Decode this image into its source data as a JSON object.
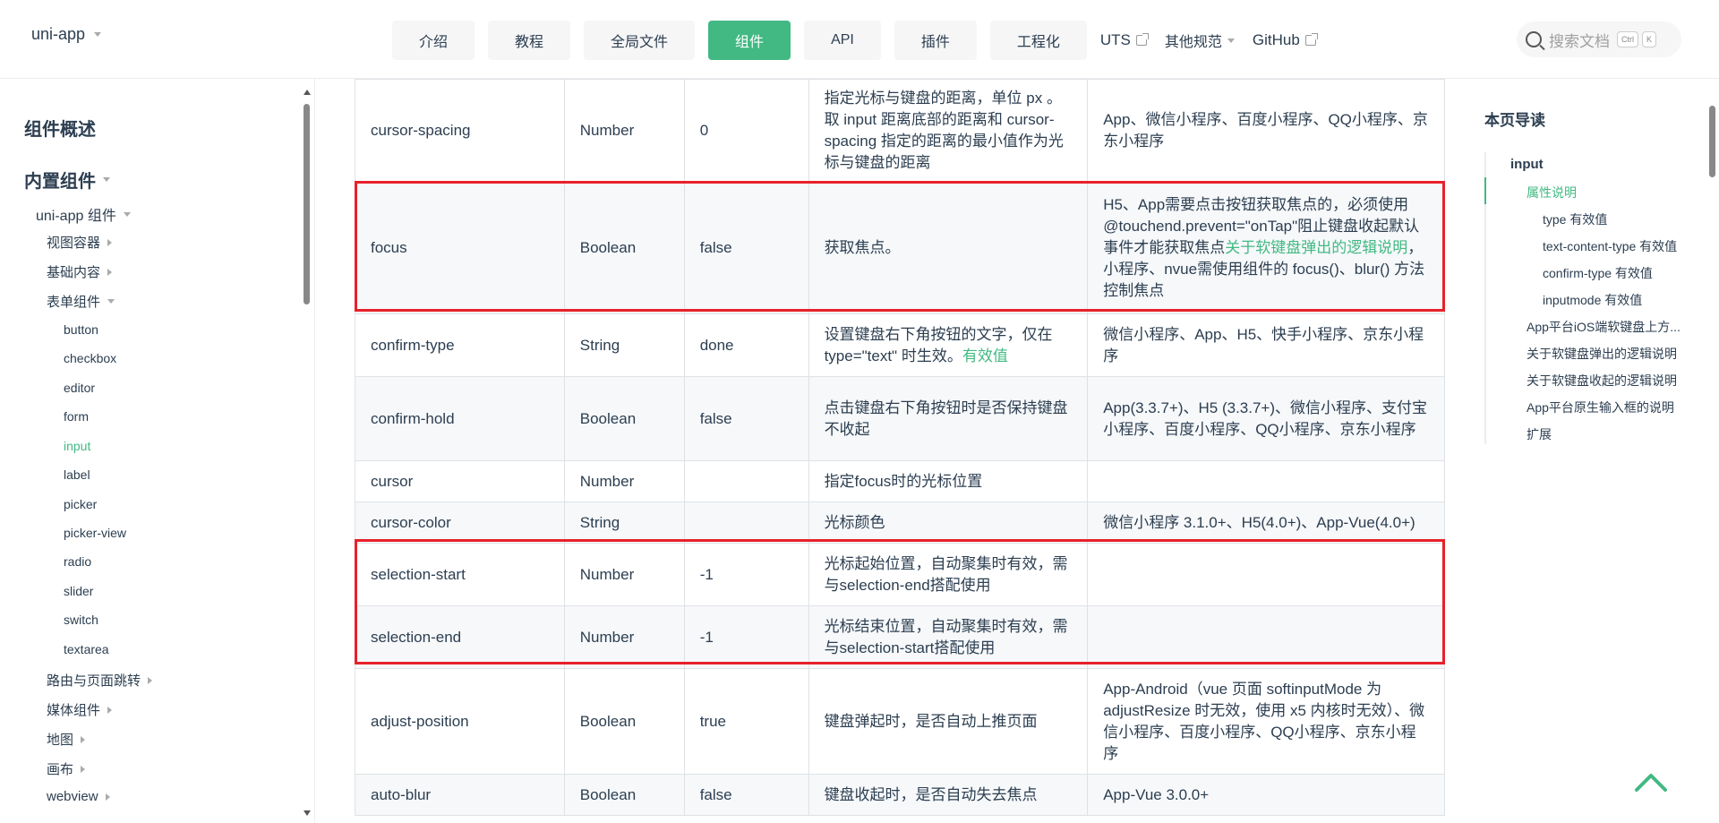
{
  "header": {
    "logo": "uni-app",
    "nav_buttons": [
      "介绍",
      "教程",
      "全局文件",
      "组件",
      "API",
      "插件",
      "工程化"
    ],
    "active_nav": "组件",
    "nav_links": [
      "UTS",
      "其他规范",
      "GitHub"
    ],
    "search_placeholder": "搜索文档",
    "search_keys": [
      "Ctrl",
      "K"
    ]
  },
  "sidebar": {
    "items": [
      {
        "label": "组件概述"
      },
      {
        "label": "内置组件"
      },
      {
        "label": "uni-app 组件"
      },
      {
        "label": "视图容器"
      },
      {
        "label": "基础内容"
      },
      {
        "label": "表单组件"
      },
      {
        "label": "button"
      },
      {
        "label": "checkbox"
      },
      {
        "label": "editor"
      },
      {
        "label": "form"
      },
      {
        "label": "input"
      },
      {
        "label": "label"
      },
      {
        "label": "picker"
      },
      {
        "label": "picker-view"
      },
      {
        "label": "radio"
      },
      {
        "label": "slider"
      },
      {
        "label": "switch"
      },
      {
        "label": "textarea"
      },
      {
        "label": "路由与页面跳转"
      },
      {
        "label": "媒体组件"
      },
      {
        "label": "地图"
      },
      {
        "label": "画布"
      },
      {
        "label": "webview"
      }
    ],
    "active": "input"
  },
  "table": {
    "rows": [
      {
        "name": "cursor-spacing",
        "type": "Number",
        "default": "0",
        "desc": "指定光标与键盘的距离，单位 px 。取 input 距离底部的距离和 cursor-spacing 指定的距离的最小值作为光标与键盘的距离",
        "platform": "App、微信小程序、百度小程序、QQ小程序、京东小程序"
      },
      {
        "name": "focus",
        "type": "Boolean",
        "default": "false",
        "desc": "获取焦点。",
        "platform_pre": "H5、App需要点击按钮获取焦点的，必须使用@touchend.prevent=\"onTap\"阻止键盘收起默认事件才能获取焦点",
        "platform_link": "关于软键盘弹出的逻辑说明",
        "platform_post": "，小程序、nvue需使用组件的 focus()、blur() 方法控制焦点"
      },
      {
        "name": "confirm-type",
        "type": "String",
        "default": "done",
        "desc_pre": "设置键盘右下角按钮的文字，仅在type=\"text\" 时生效。",
        "desc_link": "有效值",
        "platform": "微信小程序、App、H5、快手小程序、京东小程序"
      },
      {
        "name": "confirm-hold",
        "type": "Boolean",
        "default": "false",
        "desc": "点击键盘右下角按钮时是否保持键盘不收起",
        "platform": "App(3.3.7+)、H5 (3.3.7+)、微信小程序、支付宝小程序、百度小程序、QQ小程序、京东小程序"
      },
      {
        "name": "cursor",
        "type": "Number",
        "default": "",
        "desc": "指定focus时的光标位置",
        "platform": ""
      },
      {
        "name": "cursor-color",
        "type": "String",
        "default": "",
        "desc": "光标颜色",
        "platform": "微信小程序 3.1.0+、H5(4.0+)、App-Vue(4.0+)"
      },
      {
        "name": "selection-start",
        "type": "Number",
        "default": "-1",
        "desc": "光标起始位置，自动聚集时有效，需与selection-end搭配使用",
        "platform": ""
      },
      {
        "name": "selection-end",
        "type": "Number",
        "default": "-1",
        "desc": "光标结束位置，自动聚集时有效，需与selection-start搭配使用",
        "platform": ""
      },
      {
        "name": "adjust-position",
        "type": "Boolean",
        "default": "true",
        "desc": "键盘弹起时，是否自动上推页面",
        "platform": "App-Android（vue 页面 softinputMode 为 adjustResize 时无效，使用 x5 内核时无效）、微信小程序、百度小程序、QQ小程序、京东小程序"
      },
      {
        "name": "auto-blur",
        "type": "Boolean",
        "default": "false",
        "desc": "键盘收起时，是否自动失去焦点",
        "platform": "App-Vue 3.0.0+"
      }
    ]
  },
  "toc": {
    "title": "本页导读",
    "items": [
      {
        "label": "input"
      },
      {
        "label": "属性说明"
      },
      {
        "label": "type 有效值"
      },
      {
        "label": "text-content-type 有效值"
      },
      {
        "label": "confirm-type 有效值"
      },
      {
        "label": "inputmode 有效值"
      },
      {
        "label": "App平台iOS端软键盘上方..."
      },
      {
        "label": "关于软键盘弹出的逻辑说明"
      },
      {
        "label": "关于软键盘收起的逻辑说明"
      },
      {
        "label": "App平台原生输入框的说明"
      },
      {
        "label": "扩展"
      }
    ]
  },
  "colors": {
    "accent": "#42b983",
    "highlight": "#e8202a"
  }
}
